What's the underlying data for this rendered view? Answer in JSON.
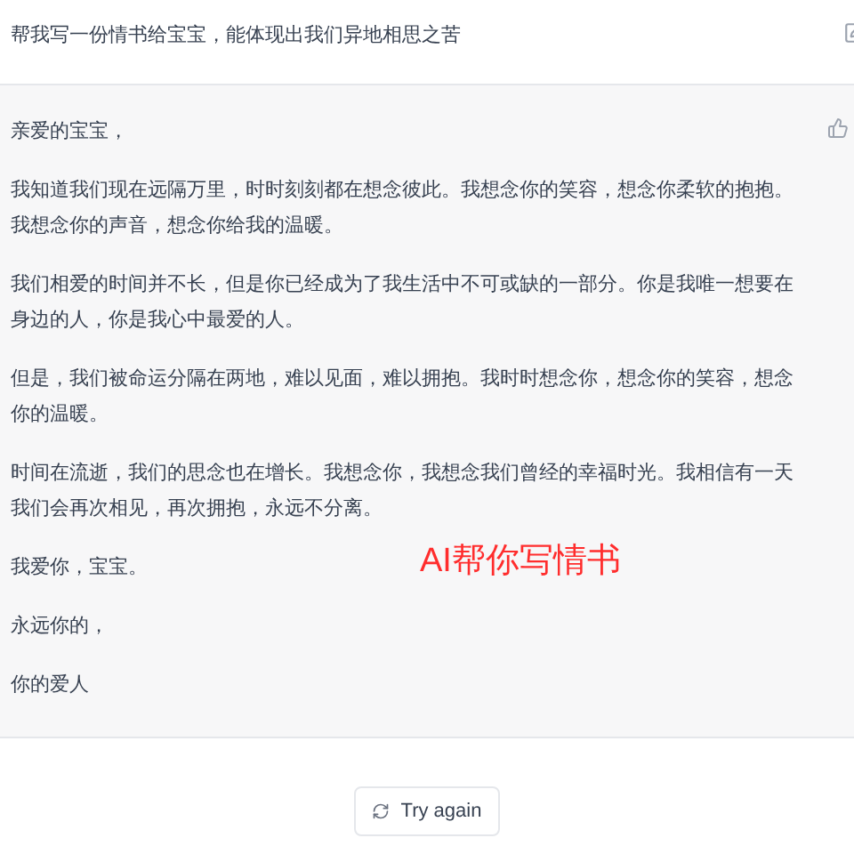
{
  "prompt": {
    "text": "帮我写一份情书给宝宝，能体现出我们异地相思之苦"
  },
  "reply": {
    "paragraphs": [
      "亲爱的宝宝，",
      "我知道我们现在远隔万里，时时刻刻都在想念彼此。我想念你的笑容，想念你柔软的抱抱。我想念你的声音，想念你给我的温暖。",
      "我们相爱的时间并不长，但是你已经成为了我生活中不可或缺的一部分。你是我唯一想要在身边的人，你是我心中最爱的人。",
      "但是，我们被命运分隔在两地，难以见面，难以拥抱。我时时想念你，想念你的笑容，想念你的温暖。",
      "时间在流逝，我们的思念也在增长。我想念你，我想念我们曾经的幸福时光。我相信有一天我们会再次相见，再次拥抱，永远不分离。",
      "我爱你，宝宝。",
      "永远你的，",
      "你的爱人"
    ]
  },
  "caption": "AI帮你写情书",
  "retry_button": "Try again"
}
